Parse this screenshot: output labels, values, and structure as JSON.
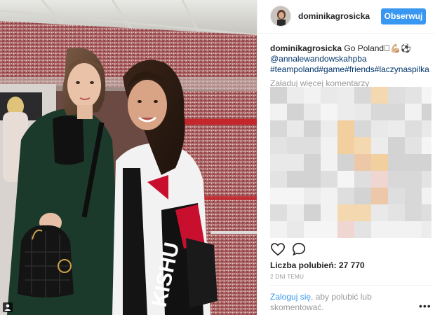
{
  "post": {
    "username": "dominikagrosicka",
    "follow_label": "Obserwuj",
    "caption_user": "dominikagrosicka",
    "caption_text": "Go Poland🏼💪🏼⚽",
    "caption_mention": "@annalewandowskahpba",
    "caption_hashtags": "#teampoland#game#friends#laczynaspilka",
    "load_more_label": "Załaduj więcej komentarzy",
    "likes_label": "Liczba polubień: 27 770",
    "date_label": "2 DNI TEMU",
    "login_link": "Zaloguj się",
    "login_rest": ", aby polubić lub skomentować.",
    "more_label": "•••"
  },
  "photo": {
    "jersey_text": "KISHU"
  },
  "icons": {
    "like": "heart-outline-icon",
    "comment": "speech-bubble-icon",
    "tag": "person-tag-icon",
    "more": "ellipsis-icon"
  },
  "colors": {
    "accent": "#3897f0",
    "link": "#003569",
    "muted": "#999999"
  }
}
